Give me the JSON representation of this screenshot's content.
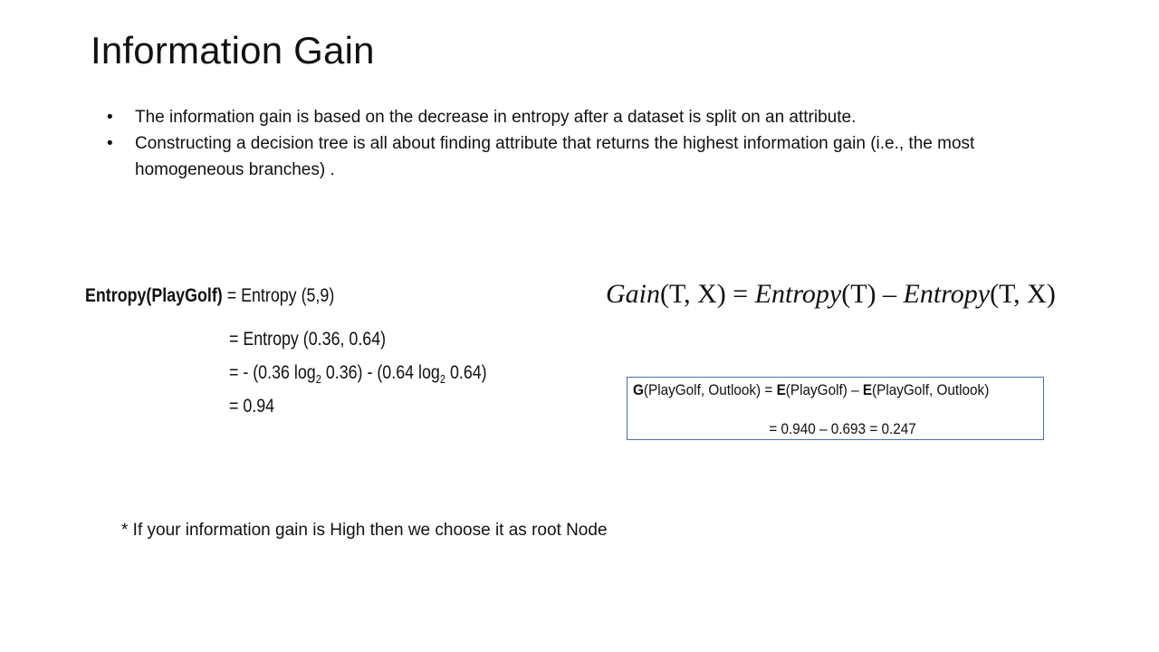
{
  "slide": {
    "title": "Information Gain",
    "bullets": [
      "The information gain is based on the decrease in entropy after a dataset is split on an attribute.",
      "Constructing a decision tree is all about finding attribute that returns the highest information gain (i.e., the most homogeneous branches) ."
    ],
    "bullet_symbol": "•"
  },
  "entropy": {
    "lhs": "Entropy(PlayGolf)",
    "eq0_rhs": "= Entropy (5,9)",
    "eq1": "= Entropy (0.36, 0.64)",
    "eq2_part1": "= - (0.36 log",
    "eq2_sub1": "2",
    "eq2_part2": " 0.36) - (0.64 log",
    "eq2_sub2": "2",
    "eq2_part3": " 0.64)",
    "eq3": "= 0.94"
  },
  "gain_formula": {
    "gain": "Gain",
    "args_lhs": "(T, X)",
    "equals": " = ",
    "entropy1": "Entropy",
    "args1": "(T)",
    "minus": " – ",
    "entropy2": "Entropy",
    "args2": "(T, X)"
  },
  "gain_example": {
    "g": "G",
    "g_args": "(PlayGolf, Outlook) = ",
    "e1": "E",
    "e1_args": "(PlayGolf) – ",
    "e2": "E",
    "e2_args": "(PlayGolf, Outlook)",
    "result": "= 0.940 – 0.693 = 0.247"
  },
  "footnote": "* If your information gain is High then we choose it as root Node"
}
